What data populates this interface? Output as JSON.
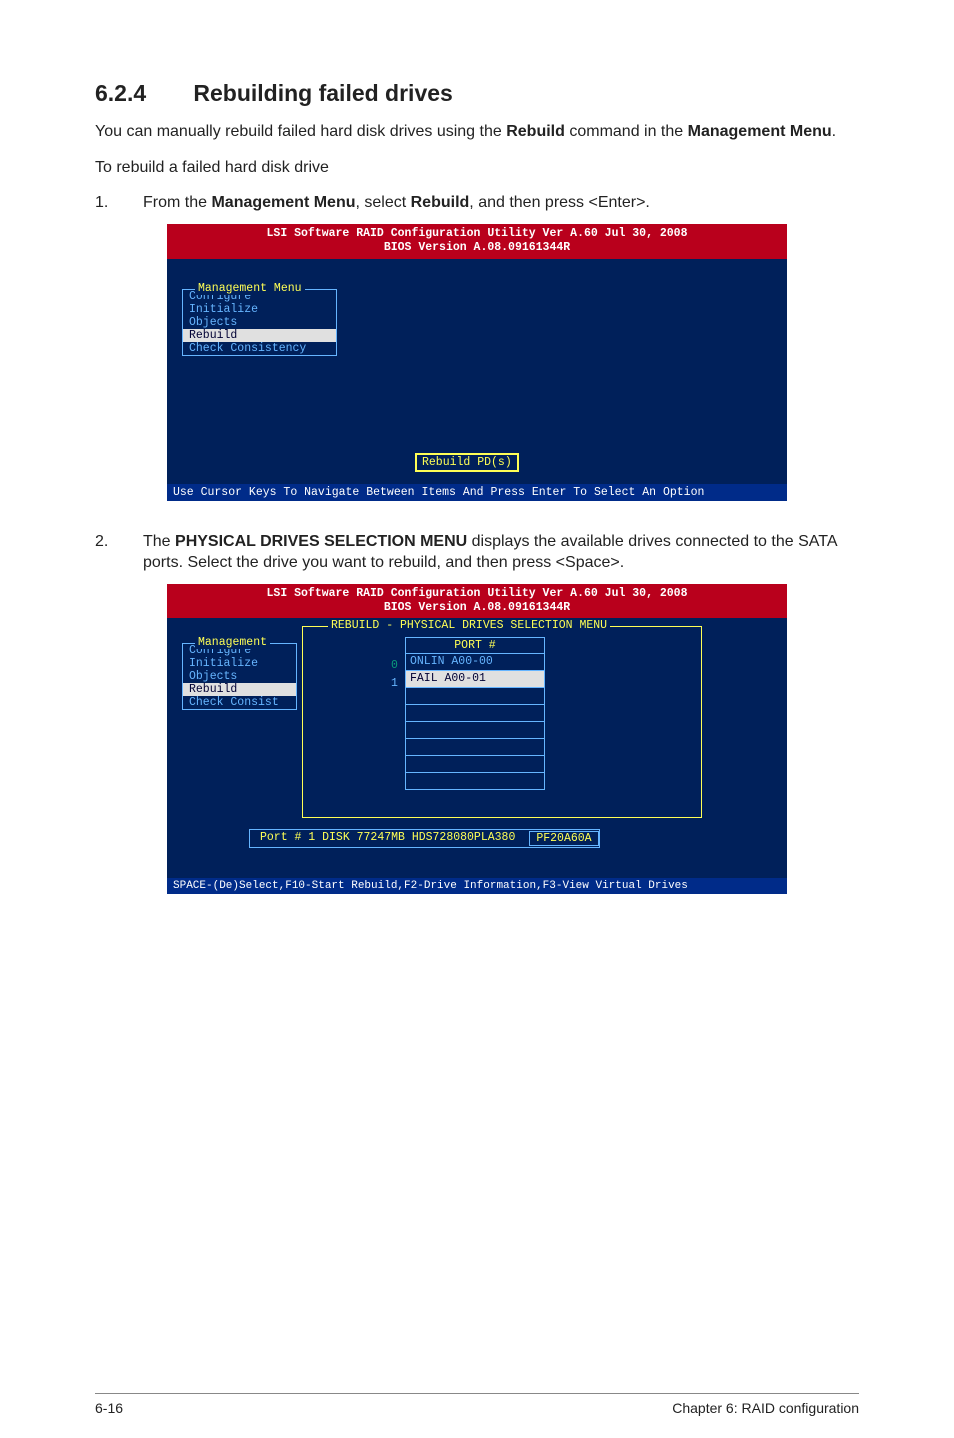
{
  "heading": {
    "number": "6.2.4",
    "title": "Rebuilding failed drives"
  },
  "intro": "You can manually rebuild failed hard disk drives using the <b>Rebuild</b> command in the <b>Management Menu</b>.",
  "intro_plain_pre": "You can manually rebuild failed hard disk drives using the ",
  "intro_bold1": "Rebuild",
  "intro_mid": " command in the ",
  "intro_bold2": "Management Menu",
  "intro_end": ".",
  "subline": "To rebuild a failed hard disk drive",
  "steps": [
    {
      "num": "1.",
      "text_pre": "From the ",
      "b1": "Management Menu",
      "mid": ", select ",
      "b2": "Rebuild",
      "end": ", and then press <Enter>."
    },
    {
      "num": "2.",
      "text_pre": "The ",
      "b1": "PHYSICAL DRIVES SELECTION MENU",
      "mid": " displays the available drives connected to the SATA ports. Select the drive you want to rebuild, and then press <Space>.",
      "b2": "",
      "end": ""
    }
  ],
  "bios_header_line1": "LSI Software RAID Configuration Utility Ver A.60 Jul 30, 2008",
  "bios_header_line2": "BIOS Version   A.08.09161344R",
  "mgmt_menu_title": "Management Menu",
  "mgmt_items": [
    "Configure",
    "Initialize",
    "Objects",
    "Rebuild",
    "Check Consistency"
  ],
  "rebuild_box": "Rebuild PD(s)",
  "footer1": "Use Cursor Keys To Navigate Between Items And Press Enter To Select An Option",
  "mgmt_menu_title2": "Management",
  "mgmt_items2": [
    "Configure",
    "Initialize",
    "Objects",
    "Rebuild",
    "Check Consist"
  ],
  "sel_menu_title": "REBUILD - PHYSICAL DRIVES SELECTION MENU",
  "port_header": "PORT #",
  "port_rows": [
    "ONLIN A00-00",
    "FAIL  A00-01",
    "",
    "",
    "",
    "",
    "",
    ""
  ],
  "port_idx": [
    "0",
    "1"
  ],
  "drive_info": {
    "pre": "Port # 1 DISK   77247MB   HDS728080PLA380",
    "last": "PF20A60A"
  },
  "footer2": "SPACE-(De)Select,F10-Start Rebuild,F2-Drive Information,F3-View Virtual Drives",
  "page_footer_left": "6-16",
  "page_footer_right": "Chapter 6: RAID configuration"
}
